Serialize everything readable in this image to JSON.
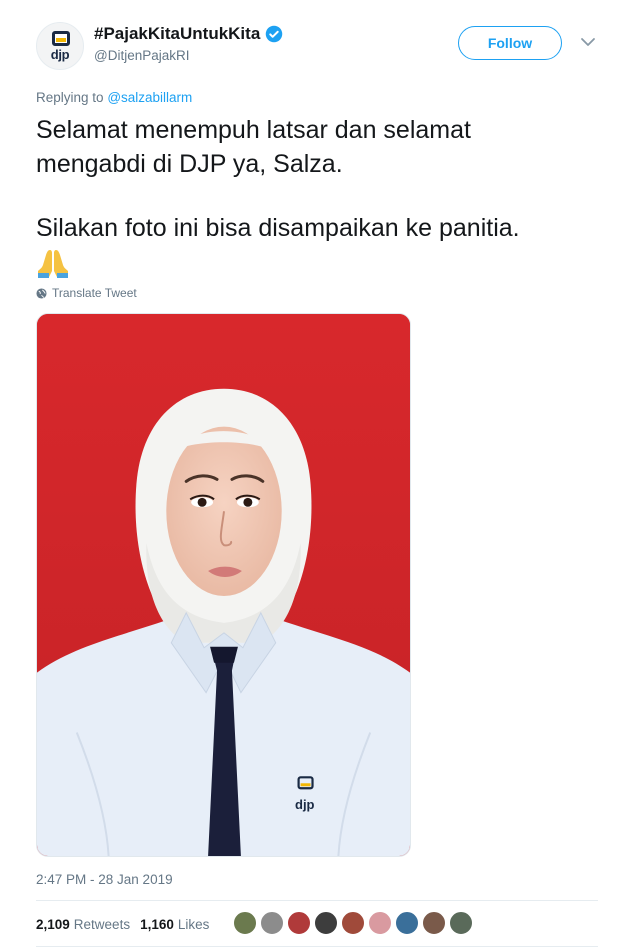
{
  "account": {
    "display_name": "#PajakKitaUntukKita",
    "handle": "@DitjenPajakRI",
    "avatar_logo_text": "djp",
    "verified": true
  },
  "follow_label": "Follow",
  "reply": {
    "prefix": "Replying to",
    "mention": "@salzabillarm"
  },
  "tweet": {
    "line1": "Selamat menempuh latsar dan selamat",
    "line2": "mengabdi di DJP ya, Salza.",
    "line3": "Silakan foto ini bisa disampaikan ke panitia.",
    "emoji": "folded-hands-emoji"
  },
  "translate_label": "Translate Tweet",
  "photo": {
    "badge_text": "djp"
  },
  "timestamp": "2:47 PM - 28 Jan 2019",
  "stats": {
    "retweets_count": "2,109",
    "retweets_label": "Retweets",
    "likes_count": "1,160",
    "likes_label": "Likes"
  },
  "likers_colors": [
    "#6b7a4e",
    "#8c8c8c",
    "#b03a3a",
    "#3d3d3d",
    "#a04a3a",
    "#d99aa0",
    "#3a6f9a",
    "#7a5a4a",
    "#5a6a5a"
  ],
  "colors": {
    "accent": "#1da1f2",
    "photo_background": "#d42a2e",
    "secondary_text": "#657786"
  }
}
